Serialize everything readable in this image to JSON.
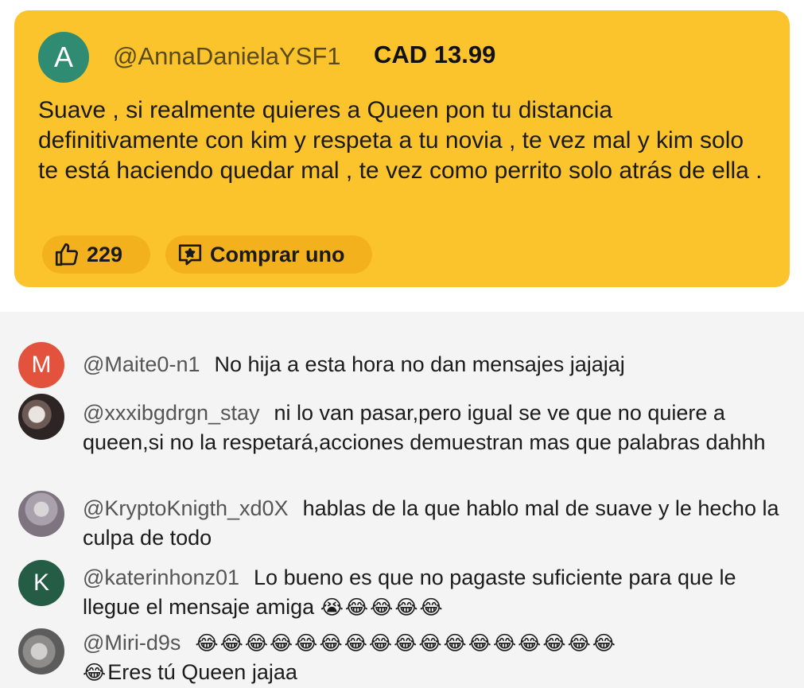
{
  "supercomment": {
    "avatar_letter": "A",
    "username": "@AnnaDanielaYSF1",
    "amount": "CAD 13.99",
    "text": "Suave , si realmente quieres a Queen pon tu distancia definitivamente con kim y respeta a tu novia , te vez mal y kim solo te está haciendo quedar mal , te vez como perrito solo atrás de ella .",
    "likes": "229",
    "buy_label": "Comprar uno",
    "colors": {
      "card": "#fbc42c",
      "avatar": "#2f8c72"
    }
  },
  "comments": [
    {
      "avatar_letter": "M",
      "username": "@Maite0-n1",
      "text": "No hija a esta hora no dan mensajes jajajaj"
    },
    {
      "avatar_letter": "",
      "username": "@xxxibgdrgn_stay",
      "text": "ni lo van pasar,pero igual se ve que no quiere a queen,si no la respetará,acciones demuestran mas que palabras dahhh"
    },
    {
      "avatar_letter": "",
      "username": "@KryptoKnigth_xd0X",
      "text": "hablas de la que hablo mal de suave y le hecho la culpa de todo"
    },
    {
      "avatar_letter": "K",
      "username": "@katerinhonz01",
      "text": "Lo bueno es que no pagaste suficiente para que le llegue el mensaje amiga",
      "emoji": "😭😂😂😂😂"
    },
    {
      "avatar_letter": "",
      "username": "@Miri-d9s",
      "emoji": "😂😂😂😂😂😂😂😂😂😂😂😂😂😂😂😂😂",
      "emoji_lead": "😂",
      "text": "Eres tú Queen jajaa"
    }
  ],
  "icons": {
    "like": "thumbs-up-icon",
    "buy": "star-chat-icon"
  }
}
